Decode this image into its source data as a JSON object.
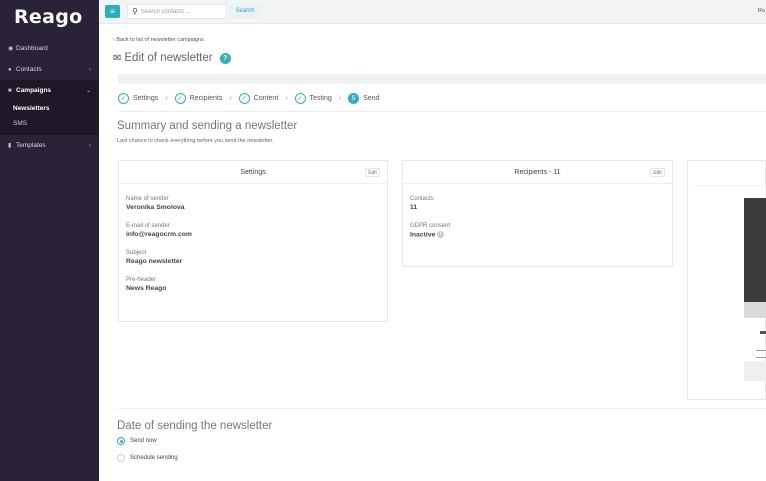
{
  "sidebar": {
    "logo": "Reago",
    "items": [
      {
        "label": "Dashboard",
        "icon": "pin-icon"
      },
      {
        "label": "Contacts",
        "icon": "users-icon"
      },
      {
        "label": "Campaigns",
        "icon": "campaign-icon"
      },
      {
        "label": "Templates",
        "icon": "template-icon"
      }
    ],
    "campaign_sub": [
      {
        "label": "Newsletters"
      },
      {
        "label": "SMS"
      }
    ]
  },
  "topbar": {
    "search_placeholder": "Search contacts ...",
    "search_button": "Search",
    "right_text": "Ro"
  },
  "main": {
    "back_link": "Back to list of newsletter campaigns",
    "page_title": "Edit of newsletter",
    "steps": [
      "Settings",
      "Recipients",
      "Content",
      "Testing",
      "Send"
    ],
    "current_step_number": "5",
    "summary_title": "Summary and sending a newsletter",
    "summary_desc": "Last chance to check everything before you send the newsletter.",
    "settings_card": {
      "title": "Settings",
      "edit": "Edit",
      "fields": [
        {
          "label": "Name of sender",
          "value": "Veronika Smolova"
        },
        {
          "label": "E-mail of sender",
          "value": "info@reagocrm.com"
        },
        {
          "label": "Subject",
          "value": "Reago newsletter"
        },
        {
          "label": "Pre-header",
          "value": "News Reago"
        }
      ]
    },
    "recipients_card": {
      "title": "Recipients - 11",
      "edit": "Edit",
      "fields": [
        {
          "label": "Contacts",
          "value": "11"
        },
        {
          "label": "GDPR consent",
          "value": "Inactive"
        }
      ]
    },
    "date_title": "Date of sending the newsletter",
    "send_now": "Send now",
    "schedule": "Schedule sending"
  },
  "colors": {
    "sidebar_bg": "#2a2236",
    "accent": "#2eb0be"
  }
}
